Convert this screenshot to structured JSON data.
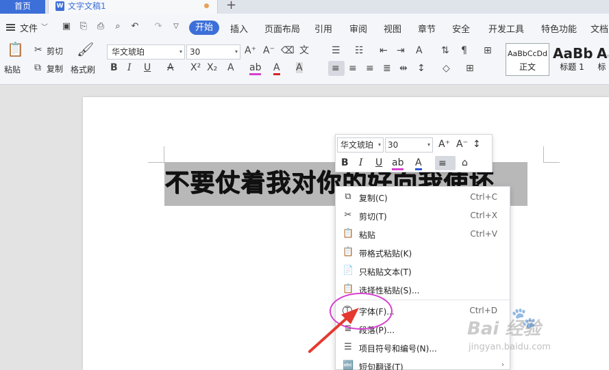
{
  "tabs": {
    "home": "首页",
    "doc_title": "文字文稿1",
    "add": "+"
  },
  "menu": {
    "file": "文件",
    "start": "开始",
    "items": [
      "插入",
      "页面布局",
      "引用",
      "审阅",
      "视图",
      "章节",
      "安全",
      "开发工具",
      "特色功能",
      "文档"
    ]
  },
  "ribbon": {
    "paste": "粘贴",
    "cut": "剪切",
    "copy": "复制",
    "format_painter": "格式刷",
    "font_name": "华文琥珀",
    "font_size": "30",
    "styles": [
      {
        "sample": "AaBbCcDd",
        "name": "正文"
      },
      {
        "sample": "AaBb",
        "name": "标题 1"
      },
      {
        "sample": "Aa",
        "name": "标"
      }
    ]
  },
  "document": {
    "headline": "不要仗着我对你的好向我使坏"
  },
  "mini_toolbar": {
    "font_name": "华文琥珀",
    "font_size": "30"
  },
  "context_menu": {
    "items": [
      {
        "icon": "copy-icon",
        "label": "复制(C)",
        "shortcut": "Ctrl+C"
      },
      {
        "icon": "scissors-icon",
        "label": "剪切(T)",
        "shortcut": "Ctrl+X"
      },
      {
        "icon": "paste-icon",
        "label": "粘贴",
        "shortcut": "Ctrl+V"
      },
      {
        "icon": "paste-format-icon",
        "label": "带格式粘贴(K)",
        "shortcut": ""
      },
      {
        "icon": "paste-text-icon",
        "label": "只粘贴文本(T)",
        "shortcut": ""
      },
      {
        "icon": "paste-special-icon",
        "label": "选择性粘贴(S)...",
        "shortcut": ""
      },
      {
        "icon": "font-icon",
        "label": "字体(F)...",
        "shortcut": "Ctrl+D"
      },
      {
        "icon": "paragraph-icon",
        "label": "段落(P)...",
        "shortcut": ""
      },
      {
        "icon": "list-icon",
        "label": "项目符号和编号(N)...",
        "shortcut": ""
      },
      {
        "icon": "translate-icon",
        "label": "短句翻译(T)",
        "shortcut": ""
      }
    ]
  },
  "watermark": {
    "brand": "Bai 经验",
    "url": "jingyan.baidu.com"
  },
  "colors": {
    "accent": "#3d6fd8",
    "annotation": "#d63fd0",
    "arrow": "#e5392f"
  }
}
